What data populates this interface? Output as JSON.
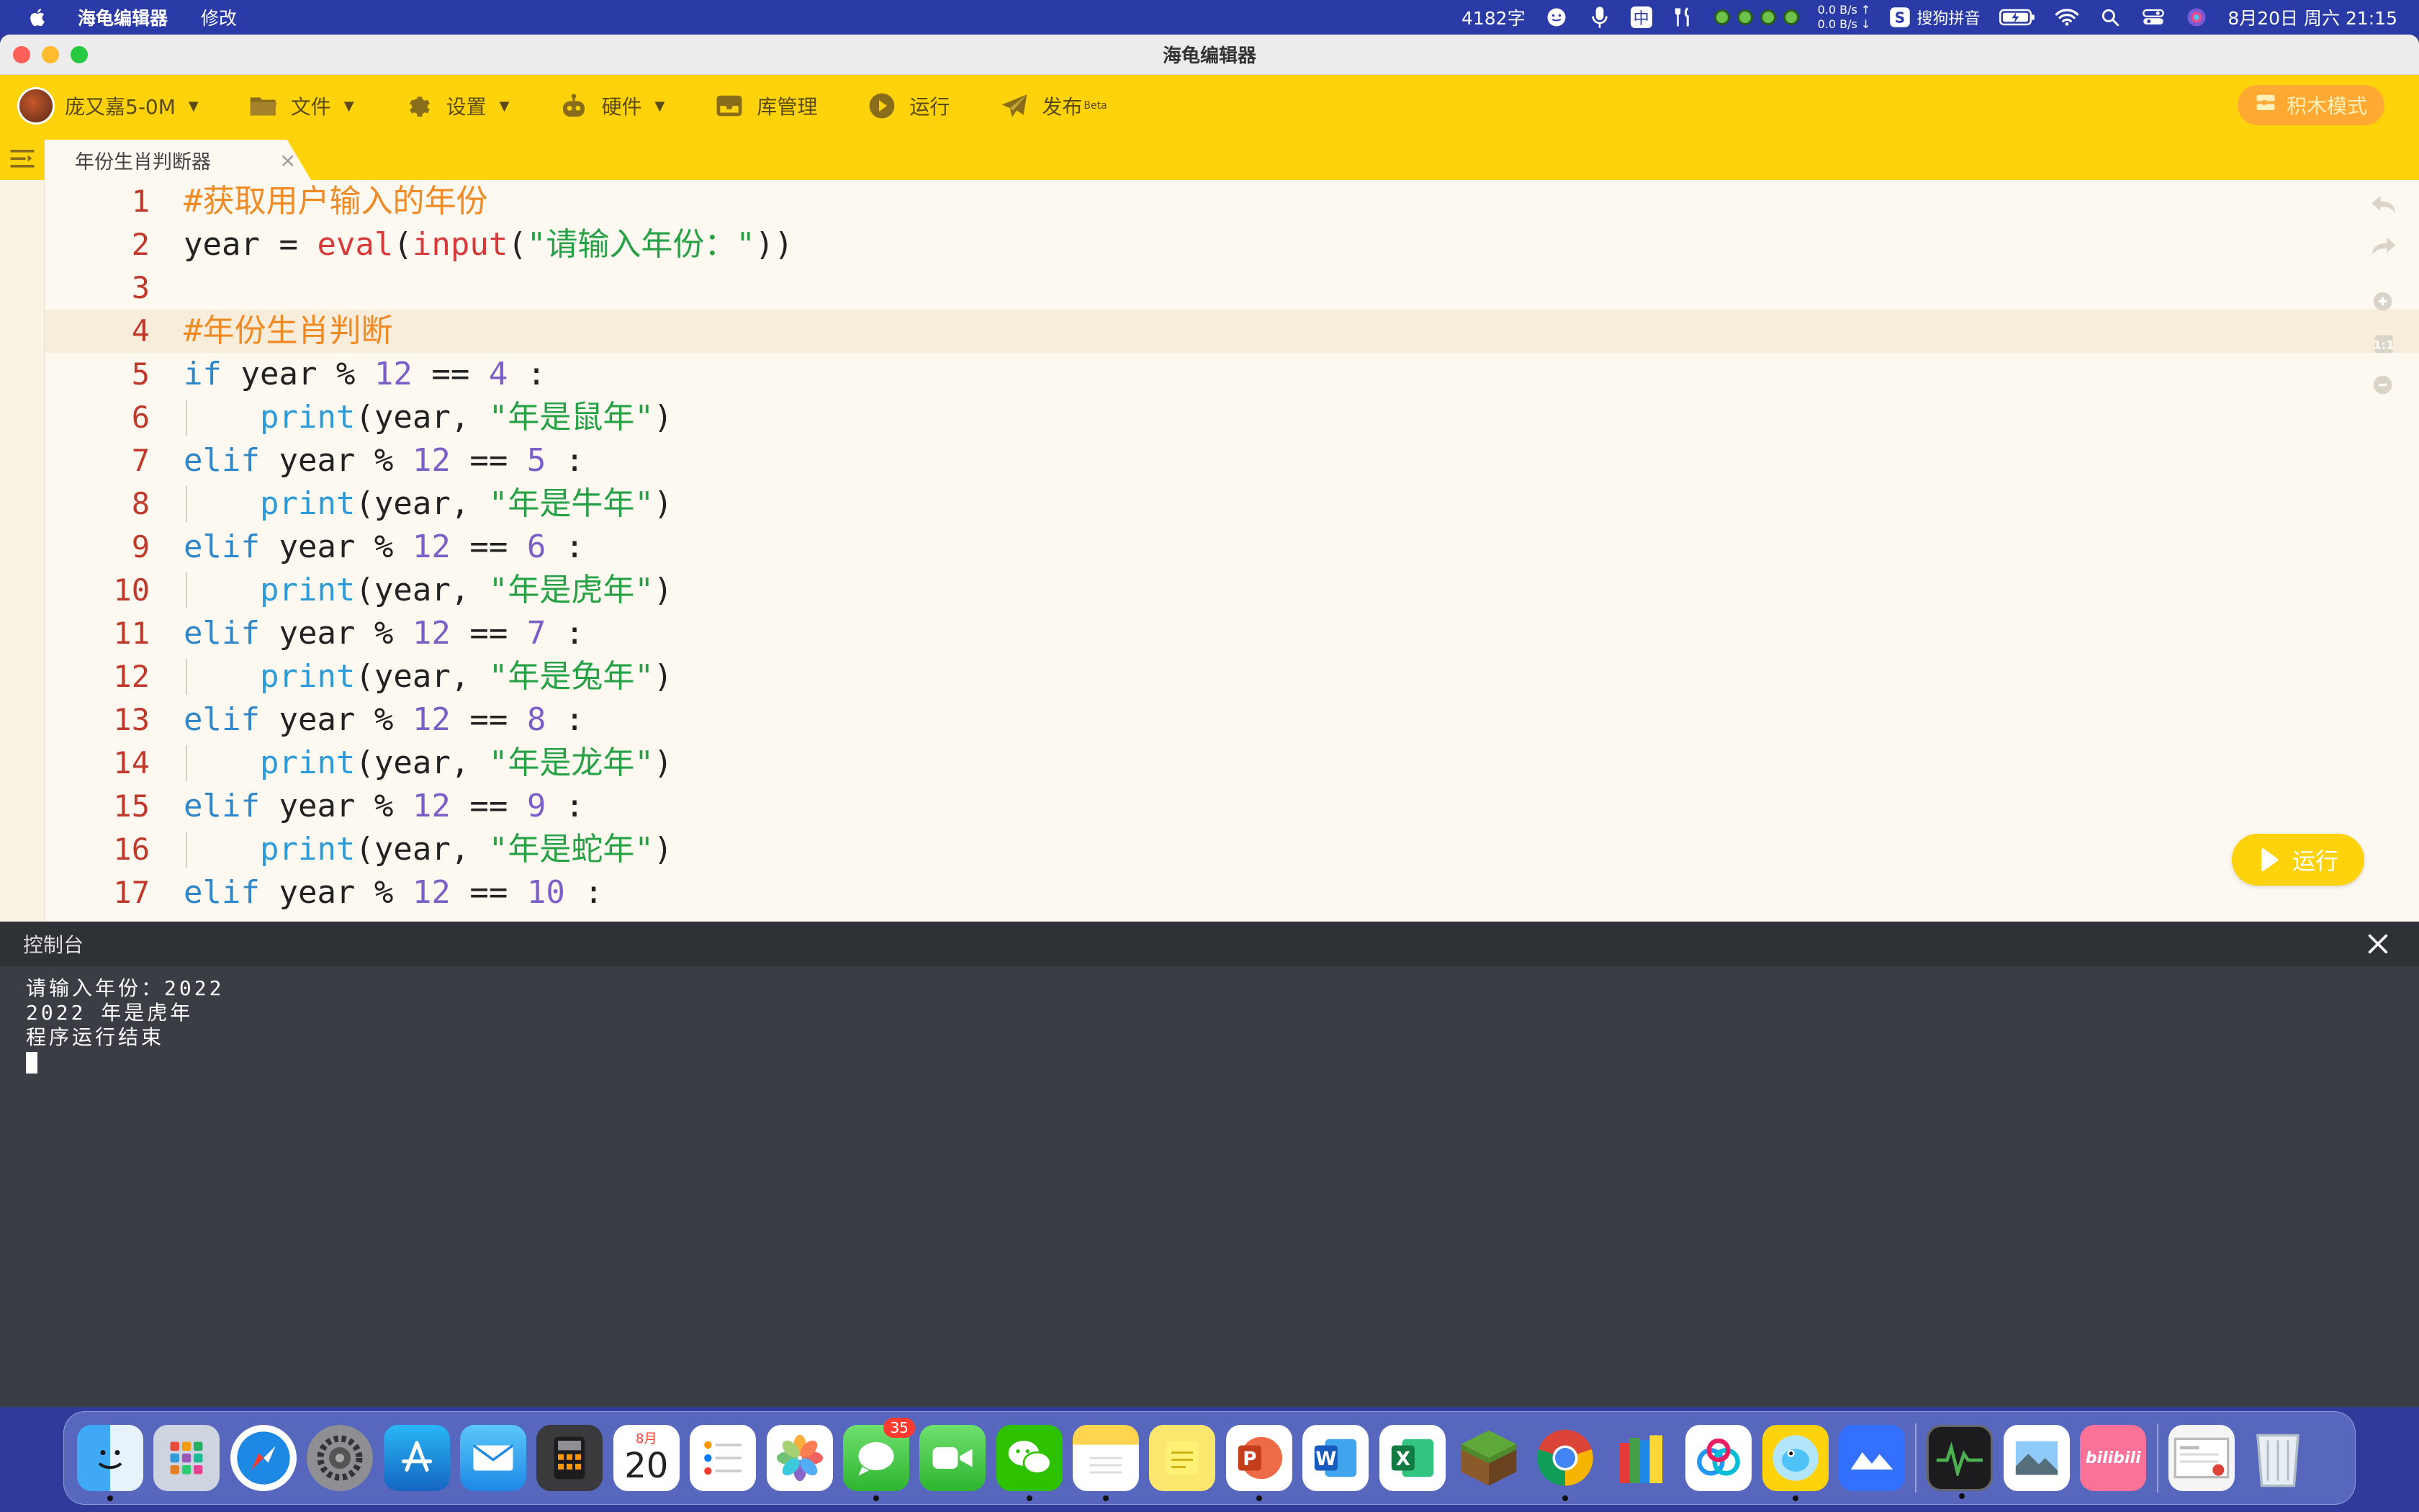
{
  "menubar": {
    "app_name": "海龟编辑器",
    "menu_edit": "修改",
    "char_count": "4182字",
    "ime_label": "中",
    "net_up": "0.0 B/s ↑",
    "net_down": "0.0 B/s ↓",
    "input_method": "搜狗拼音",
    "datetime": "8月20日 周六 21:15"
  },
  "window": {
    "title": "海龟编辑器"
  },
  "toolbar": {
    "user_name": "庞又嘉5-0M",
    "file_label": "文件",
    "settings_label": "设置",
    "hardware_label": "硬件",
    "library_label": "库管理",
    "run_label": "运行",
    "publish_label": "发布",
    "publish_beta": "Beta",
    "block_mode_label": "积木模式"
  },
  "tabs": [
    {
      "label": "年份生肖判断器",
      "close": "×"
    }
  ],
  "editor": {
    "current_line": 4,
    "line_numbers": [
      "1",
      "2",
      "3",
      "4",
      "5",
      "6",
      "7",
      "8",
      "9",
      "10",
      "11",
      "12",
      "13",
      "14",
      "15",
      "16",
      "17"
    ],
    "run_button_label": "运行"
  },
  "console": {
    "title": "控制台",
    "lines": [
      "请输入年份：2022",
      "2022 年是虎年",
      "程序运行结束"
    ]
  },
  "dock": {
    "calendar_month": "8月",
    "calendar_day": "20",
    "messages_badge": "35",
    "word_letter": "W",
    "excel_letter": "X",
    "ppt_letter": "P",
    "bilibili_label": "bilibili"
  },
  "colors": {
    "toolbar_bg": "#ffd30b",
    "editor_bg": "#fdf9f0",
    "console_bg": "#3a3e44",
    "comment": "#f08a24",
    "keyword": "#2f86c8",
    "number": "#7a5fc8",
    "string": "#26a146"
  }
}
